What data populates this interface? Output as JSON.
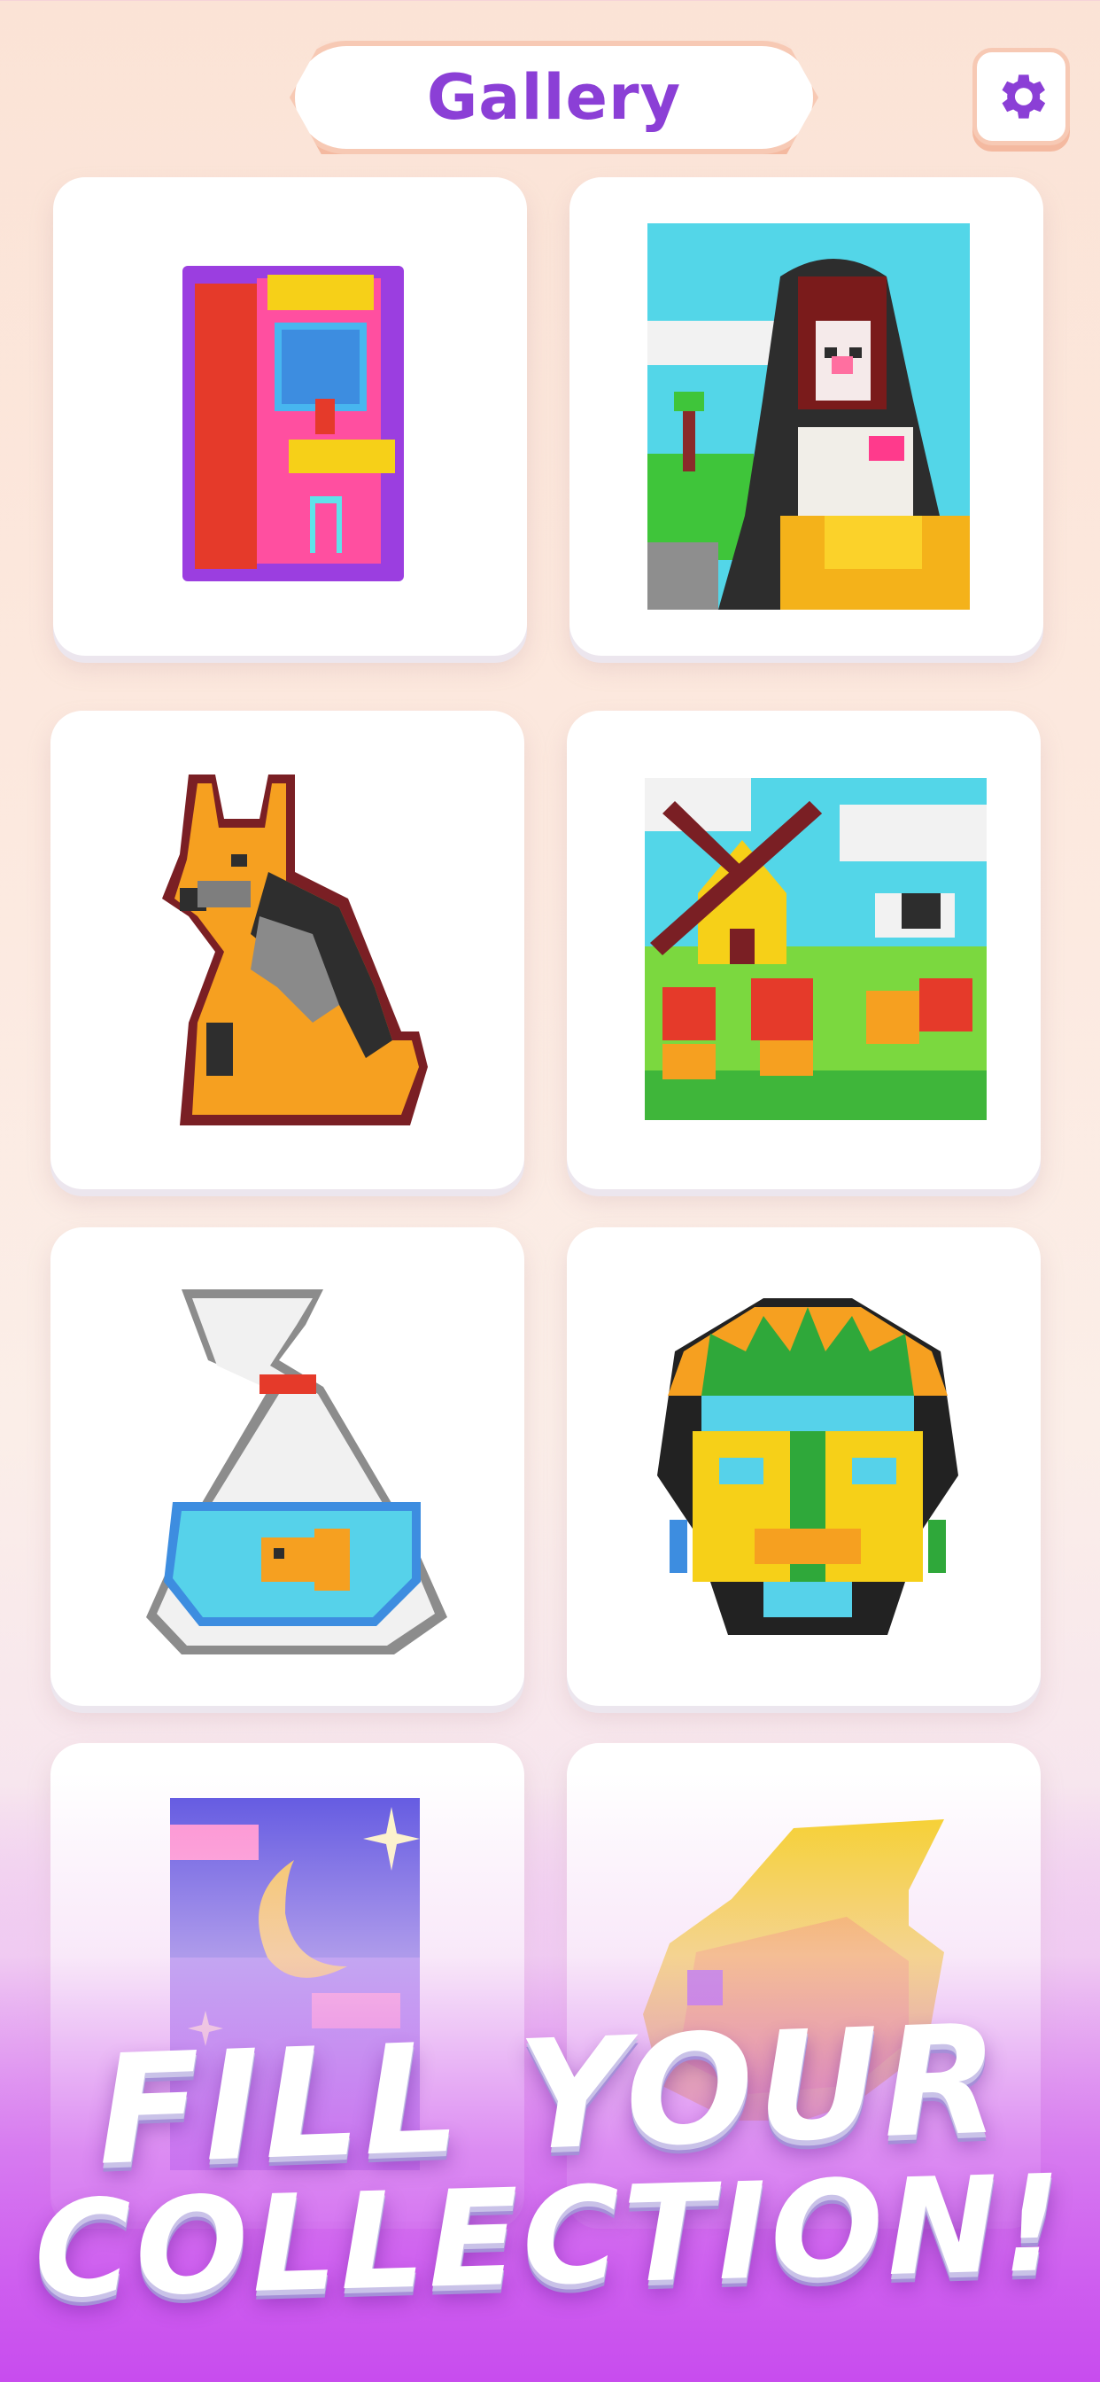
{
  "header": {
    "title": "Gallery"
  },
  "settings": {
    "icon": "gear-icon",
    "color": "#8b3fd6"
  },
  "gallery": {
    "items": [
      {
        "subject": "arcade machine"
      },
      {
        "subject": "mona lisa"
      },
      {
        "subject": "german shepherd dog"
      },
      {
        "subject": "windmill with tulips"
      },
      {
        "subject": "goldfish in bag"
      },
      {
        "subject": "tribal mask"
      },
      {
        "subject": "night sky with moon"
      },
      {
        "subject": "fish"
      }
    ]
  },
  "promo": {
    "line1": "FILL YOUR",
    "line2": "COLLECTION!"
  },
  "colors": {
    "accent": "#8b3fd6",
    "bottom_gradient": "#c84cee"
  }
}
